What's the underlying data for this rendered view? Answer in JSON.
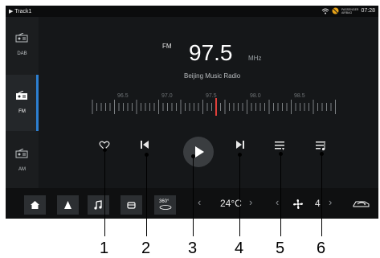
{
  "status": {
    "track": "Track1",
    "passenger_line1": "PASSENGER",
    "passenger_line2": "AIRBAG",
    "time": "07:28"
  },
  "sources": [
    {
      "label": "DAB"
    },
    {
      "label": "FM"
    },
    {
      "label": "AM"
    }
  ],
  "radio": {
    "band": "FM",
    "frequency": "97.5",
    "unit": "MHz",
    "station": "Beijing Music Radio"
  },
  "scale_labels": [
    "96.5",
    "97.0",
    "97.5",
    "98.0",
    "98.5"
  ],
  "accent": {
    "needle": "#e0403a",
    "active_bar": "#2d7fd0"
  },
  "bottom": {
    "view_360": "360°",
    "temperature": "24°C",
    "fan_level": "4"
  },
  "callouts": [
    "1",
    "2",
    "3",
    "4",
    "5",
    "6"
  ]
}
